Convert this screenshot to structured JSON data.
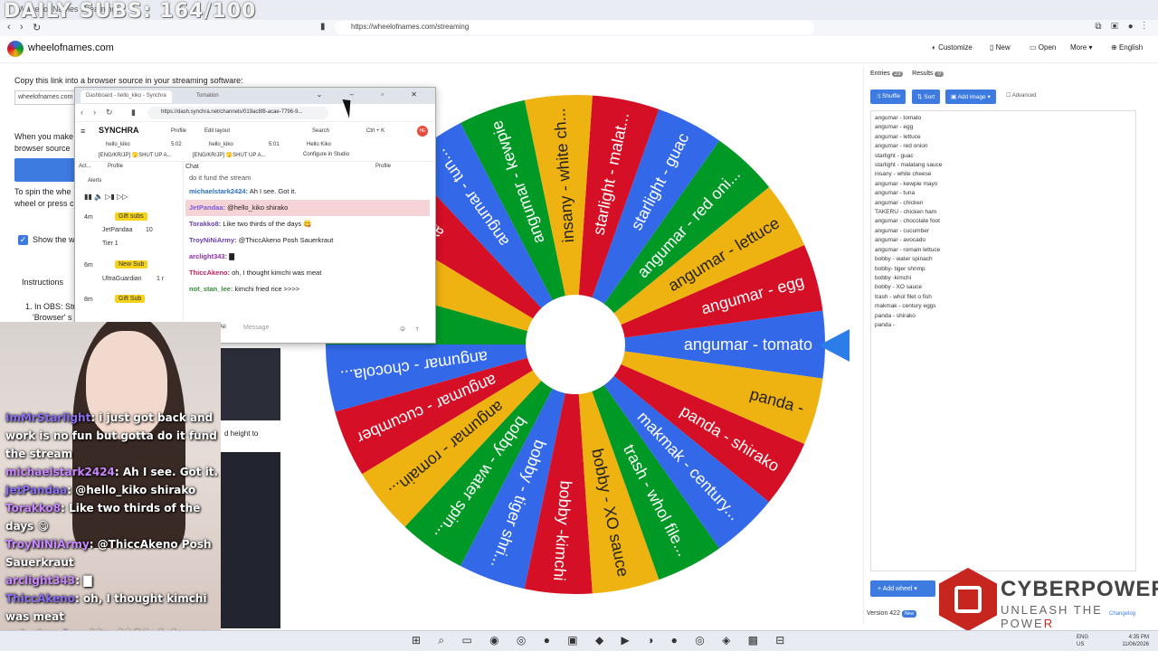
{
  "overlay_subs": "DAILY SUBS: 164/100",
  "browser": {
    "tab_title": "Wheel of Names streaming",
    "url": "https://wheelofnames.com/streaming"
  },
  "site": {
    "name": "wheelofnames.com",
    "menu": [
      "Customize",
      "New",
      "Open",
      "More",
      "English"
    ]
  },
  "left_panel": {
    "copy_text": "Copy this link into a browser source in your streaming software:",
    "link_field": "wheelofnames.com",
    "when_text": "When you make",
    "browser_source": "browser source",
    "spin_text": "To spin the whe",
    "wheel_press": "wheel or press c",
    "show_text": "Show the w",
    "instructions": "Instructions",
    "step1": "1. In OBS: Stu",
    "step1b": "'Browser' s",
    "height_text": "d height to"
  },
  "popup": {
    "tabs": [
      "Dashboard - hello_kiko - Synchra",
      "Tornation"
    ],
    "url": "https://dash.synchra.net/channels/019ac8f8-acae-7796-9...",
    "app_name": "SYNCHRA",
    "profile": "Profile",
    "edit_layout": "Edit layout",
    "search": "Search",
    "shortcut": "Ctrl + K",
    "avatar": "HE",
    "channels": [
      {
        "name": "hello_kiko",
        "time": "5:02",
        "desc": "[ENG/KR/JP] 🫣SHUT UP A..."
      },
      {
        "name": "hello_kiko",
        "time": "5:01",
        "desc": "[ENG/KR/JP] 🫣SHUT UP A..."
      },
      {
        "name": "Hello Kiko",
        "time": "",
        "desc": "Configure in Studio"
      }
    ],
    "activity_label": "Act...",
    "activity_profile": "Profile",
    "alerts": "Alerts",
    "activity": [
      {
        "time": "4m",
        "type": "Gift subs",
        "user": "JetPandaa",
        "extra": "10",
        "tier": "Tier 1"
      },
      {
        "time": "6m",
        "type": "New Sub",
        "user": "UltraGuardian",
        "extra": "1 r",
        "tier": ""
      },
      {
        "time": "8m",
        "type": "Gift Sub",
        "user": "",
        "extra": "",
        "tier": ""
      }
    ],
    "chat_label": "Chat",
    "chat_profile": "Profile",
    "chat_top": "do it fund the stream",
    "chat": [
      {
        "user": "michaelstark2424:",
        "msg": " Ah I see. Got it.",
        "color": "#2a6fc0",
        "hl": false
      },
      {
        "user": "JetPandaa:",
        "msg": " @hello_kiko shirako",
        "color": "#7a5bd6",
        "hl": true
      },
      {
        "user": "Torakko8:",
        "msg": " Like two thirds of the days 😋",
        "color": "#6a40b8",
        "hl": false
      },
      {
        "user": "TroyNiNiArmy:",
        "msg": " @ThiccAkeno Posh Sauerkraut",
        "color": "#6a40b8",
        "hl": false
      },
      {
        "user": "arclight343:",
        "msg": " ▇",
        "color": "#8a2fb0",
        "hl": false
      },
      {
        "user": "ThiccAkeno:",
        "msg": " oh, I thought kimchi was meat",
        "color": "#c02060",
        "hl": false
      },
      {
        "user": "not_stan_lee:",
        "msg": " kimchi fried rice >>>>",
        "color": "#3a8a3a",
        "hl": false
      }
    ],
    "message_placeholder": "Message",
    "all": "All"
  },
  "overlay_chat": [
    {
      "user": "ImMrStarlight",
      "msg": ": i just got back and"
    },
    {
      "user": "",
      "msg": "work is no fun but gotta do it fund"
    },
    {
      "user": "",
      "msg": "the stream"
    },
    {
      "user": "michaelstark2424",
      "msg": ": Ah I see. Got it."
    },
    {
      "user": "JetPandaa",
      "msg": ": @hello_kiko shirako"
    },
    {
      "user": "Torakko8",
      "msg": ": Like two thirds of the"
    },
    {
      "user": "",
      "msg": "days 😋"
    },
    {
      "user": "TroyNiNiArmy",
      "msg": ": @ThiccAkeno Posh"
    },
    {
      "user": "",
      "msg": "Sauerkraut"
    },
    {
      "user": "arclight343",
      "msg": ": ▇"
    },
    {
      "user": "ThiccAkeno",
      "msg": ": oh, I thought kimchi"
    },
    {
      "user": "",
      "msg": "was meat"
    },
    {
      "user": "not_stan_lee",
      "msg": ": kimchi fried rice >>>>"
    }
  ],
  "wheel": {
    "colors": [
      "#3369e8",
      "#d50f25",
      "#eeb211",
      "#009925"
    ],
    "segments": [
      "angumar - tomato",
      "angumar - egg",
      "angumar - lettuce",
      "angumar - red oni...",
      "starlight - guac",
      "starlight - malat...",
      "insany - white ch...",
      "angumar - kewpie",
      "angumar - tun...",
      "angumar",
      "TAKERU",
      "angumar",
      "angumar - chocola...",
      "angumar - cucumber",
      "angumar - romain...",
      "bobby - water spin...",
      "bobby - tiger shri...",
      "bobby -kimchi",
      "bobby - XO sauce",
      "trash - whol file...",
      "makmak - century...",
      "panda - shirako",
      "panda -"
    ]
  },
  "right_panel": {
    "tab_entries": "Entries",
    "entries_count": "23",
    "tab_results": "Results",
    "results_count": "0",
    "btn_shuffle": "Shuffle",
    "btn_sort": "Sort",
    "btn_add_image": "Add image",
    "advanced": "Advanced",
    "entries": [
      "angumar - tomato",
      "angumar - egg",
      "angumar - lettuce",
      "angumar - red onion",
      "starlight - guac",
      "starlight - malatang sauce",
      "insany - white cheese",
      "angumar - kewpie mayo",
      "angumar - tuna",
      "angumar - chicken",
      "TAKERU - chicken ham",
      "angumar - chocolate foot",
      "angumar - cucumber",
      "angumar - avocado",
      "angumar - romain lettuce",
      "bobby - water spinach",
      "bobby- tiger shrimp",
      "bobby -kimchi",
      "bobby - XO sauce",
      "trash - whol filet o fish",
      "makmak - century eggs",
      "panda - shirako",
      "panda -"
    ],
    "add_wheel": "Add wheel",
    "version": "Version 422",
    "new_badge": "New",
    "changelog": "Changelog"
  },
  "sponsor": {
    "name": "CYBERPOWER",
    "pc": "PC",
    "tagline": "UNLEASH THE POWE",
    "tagline_red": "R"
  },
  "taskbar": {
    "lang1": "ENG",
    "lang2": "US",
    "time": "4:35 PM",
    "date": "11/06/2026"
  }
}
